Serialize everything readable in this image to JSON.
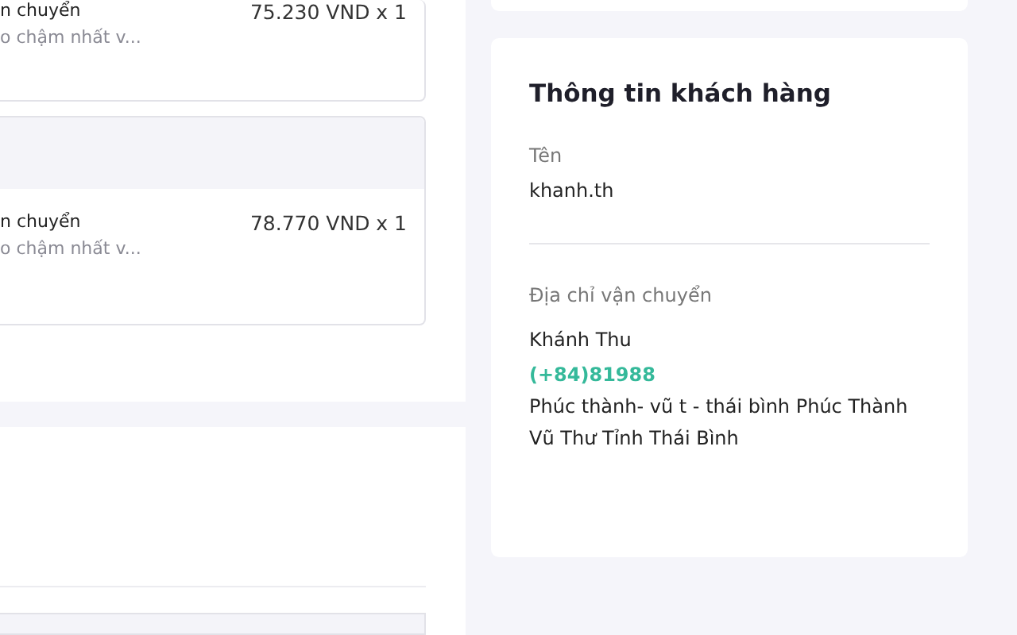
{
  "order_items": [
    {
      "header": false,
      "name": "n chuyển",
      "note": "o chậm nhất v...",
      "price": "75.230 VND x 1"
    },
    {
      "header": true,
      "name": "n chuyển",
      "note": "o chậm nhất v...",
      "price": "78.770 VND x 1"
    }
  ],
  "customer": {
    "title": "Thông tin khách hàng",
    "name_label": "Tên",
    "name_value": "khanh.th",
    "address_label": "Địa chỉ vận chuyển",
    "recipient": "Khánh Thu",
    "phone": "(+84)81988",
    "address": "Phúc thành- vũ t - thái bình Phúc Thành Vũ Thư Tỉnh Thái Bình"
  }
}
